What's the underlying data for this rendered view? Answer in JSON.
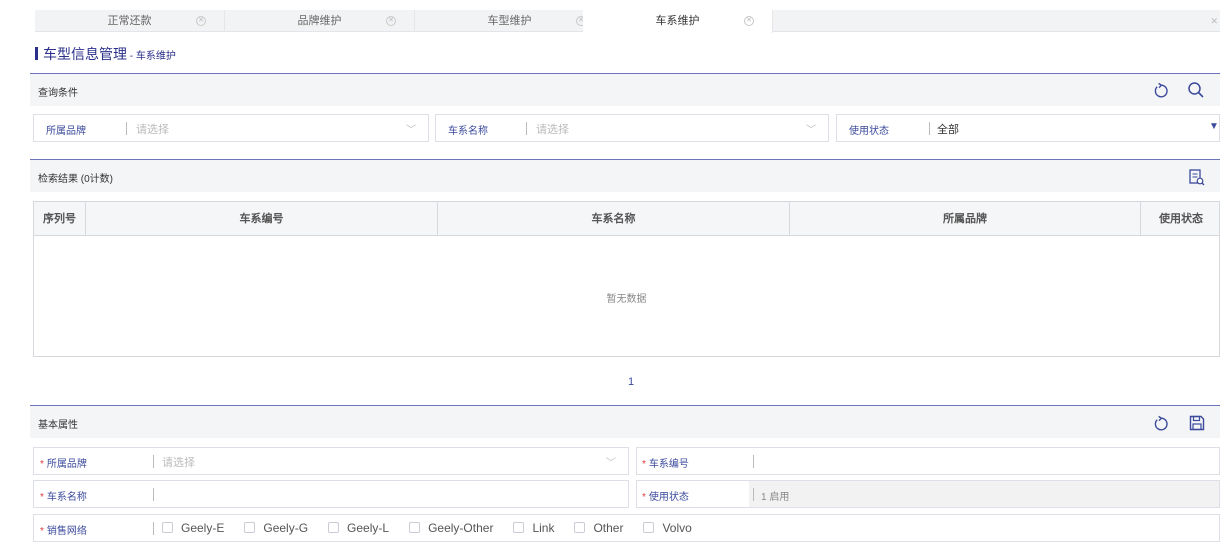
{
  "tabs": [
    {
      "label": "正常还款",
      "active": false
    },
    {
      "label": "品牌维护",
      "active": false
    },
    {
      "label": "车型维护",
      "active": false
    },
    {
      "label": "车系维护",
      "active": true
    }
  ],
  "page": {
    "title": "车型信息管理",
    "title_sep": " - ",
    "subtitle": "车系维护"
  },
  "query": {
    "header": "查询条件",
    "brand_label": "所属品牌",
    "brand_placeholder": "请选择",
    "series_label": "车系名称",
    "series_placeholder": "请选择",
    "status_label": "使用状态",
    "status_value": "全部"
  },
  "results": {
    "header": "检索结果 (0计数)",
    "columns": [
      "序列号",
      "车系编号",
      "车系名称",
      "所属品牌",
      "使用状态"
    ],
    "empty_text": "暂无数据",
    "page_number": "1"
  },
  "basic": {
    "header": "基本属性",
    "required_mark": "*",
    "brand_label": "所属品牌",
    "brand_placeholder": "请选择",
    "code_label": "车系编号",
    "name_label": "车系名称",
    "status_label": "使用状态",
    "status_value": "1 启用",
    "network_label": "销售网络",
    "networks": [
      "Geely-E",
      "Geely-G",
      "Geely-L",
      "Geely-Other",
      "Link",
      "Other",
      "Volvo"
    ]
  },
  "icons": [
    "close-icon",
    "refresh-icon",
    "search-icon",
    "export-icon",
    "save-icon",
    "chevron-down-icon"
  ],
  "colors": {
    "accent": "#3b4a9c",
    "title": "#2a2f8a",
    "required": "#e0393e"
  }
}
